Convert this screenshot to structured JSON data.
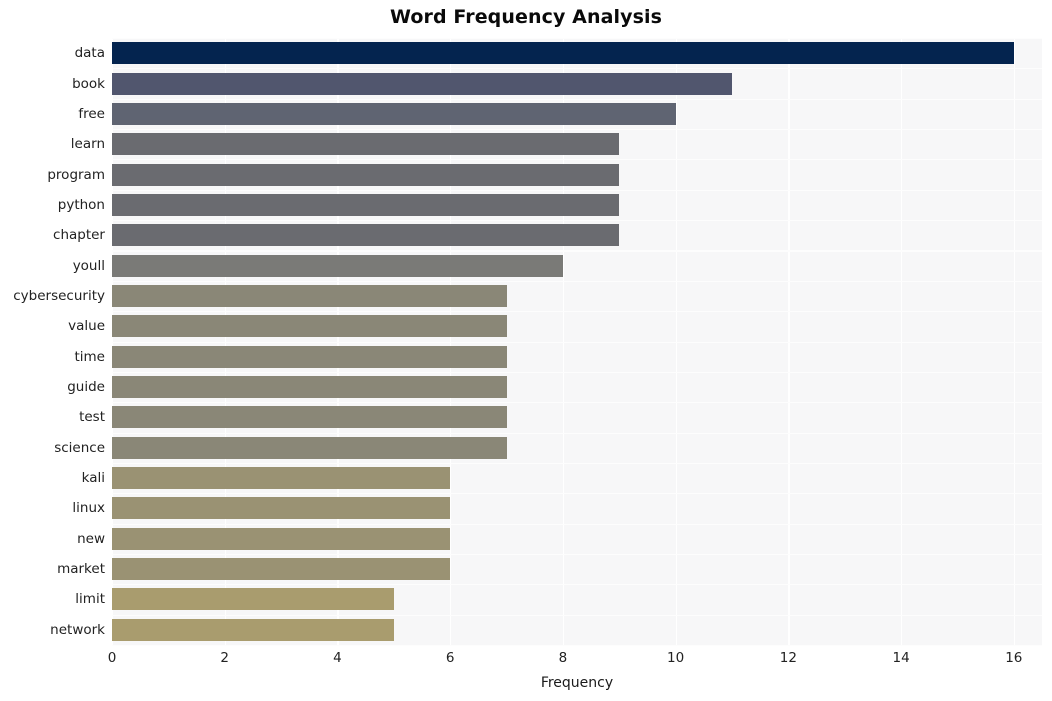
{
  "chart_data": {
    "type": "bar",
    "orientation": "horizontal",
    "title": "Word Frequency Analysis",
    "xlabel": "Frequency",
    "ylabel": "",
    "categories": [
      "data",
      "book",
      "free",
      "learn",
      "program",
      "python",
      "chapter",
      "youll",
      "cybersecurity",
      "value",
      "time",
      "guide",
      "test",
      "science",
      "kali",
      "linux",
      "new",
      "market",
      "limit",
      "network"
    ],
    "values": [
      16,
      11,
      10,
      9,
      9,
      9,
      9,
      8,
      7,
      7,
      7,
      7,
      7,
      7,
      6,
      6,
      6,
      6,
      5,
      5
    ],
    "bar_colors": [
      "#04244f",
      "#51566e",
      "#5f6472",
      "#6a6b70",
      "#6a6b70",
      "#6a6b70",
      "#6a6b70",
      "#7a7a77",
      "#8a8777",
      "#8a8777",
      "#8a8777",
      "#8a8777",
      "#8a8777",
      "#8a8777",
      "#9a9273",
      "#9a9273",
      "#9a9273",
      "#9a9273",
      "#a99c6e",
      "#a99c6e"
    ],
    "xlim": [
      0,
      16.5
    ],
    "xticks": [
      0,
      2,
      4,
      6,
      8,
      10,
      12,
      14,
      16
    ],
    "xtick_labels": [
      "0",
      "2",
      "4",
      "6",
      "8",
      "10",
      "12",
      "14",
      "16"
    ],
    "grid": true,
    "grid_color": "#ffffff",
    "plot_background": "#f7f7f8",
    "figure_background": "#ffffff",
    "legend": null
  }
}
